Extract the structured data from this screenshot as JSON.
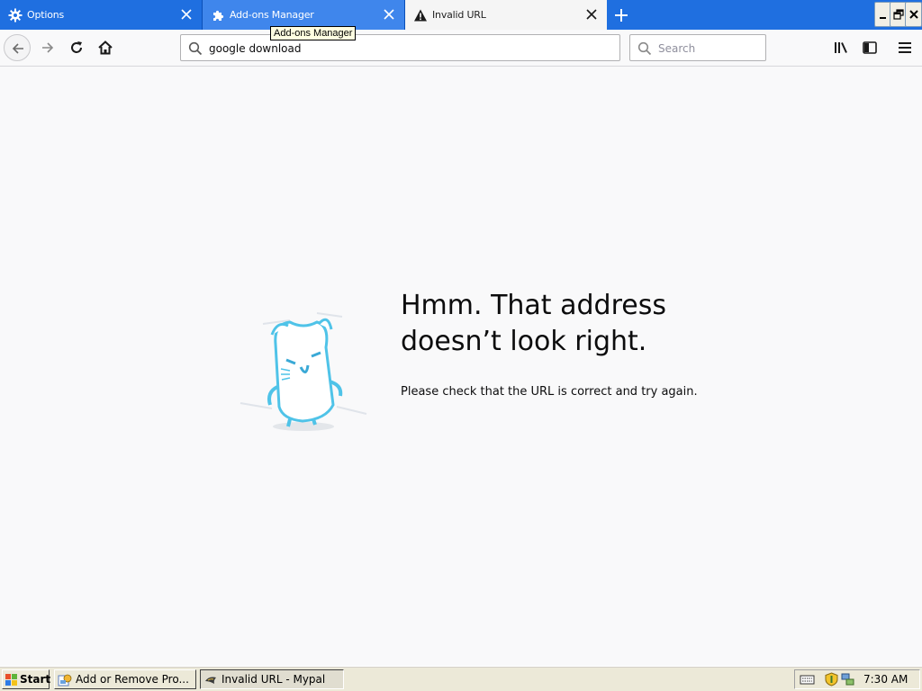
{
  "browser": {
    "tabs": [
      {
        "label": "Options",
        "icon": "gear-icon",
        "active": false
      },
      {
        "label": "Add-ons Manager",
        "icon": "puzzle-icon",
        "active": false
      },
      {
        "label": "Invalid URL",
        "icon": "warning-icon",
        "active": true
      }
    ],
    "tooltip": "Add-ons Manager",
    "url_bar": {
      "value": "google download"
    },
    "search_bar": {
      "placeholder": "Search"
    }
  },
  "error_page": {
    "title_line1": "Hmm. That address",
    "title_line2": "doesn’t look right.",
    "description": "Please check that the URL is correct and try again."
  },
  "taskbar": {
    "start_label": "Start",
    "buttons": [
      {
        "label": "Add or Remove Pro..."
      },
      {
        "label": "Invalid URL - Mypal"
      }
    ],
    "clock": "7:30 AM"
  },
  "colors": {
    "tab_strip": "#1f6fe0",
    "active_tab": "#f5f5f5",
    "page_background": "#f9f9fa",
    "taskbar": "#ece9d8"
  }
}
